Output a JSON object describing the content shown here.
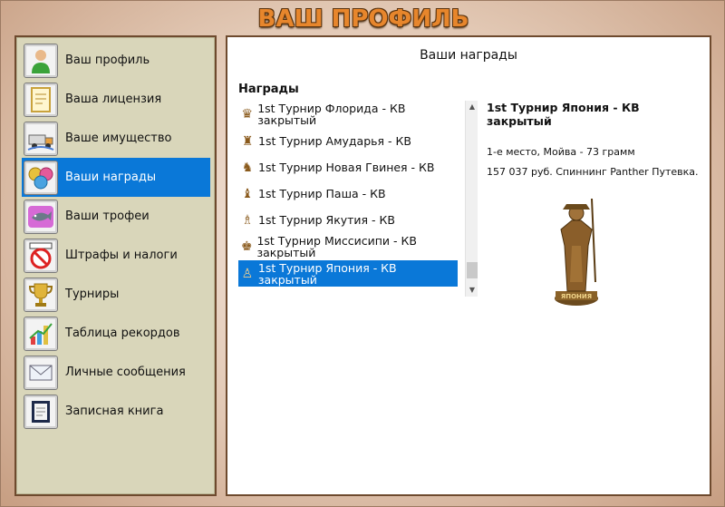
{
  "title": "ВАШ ПРОФИЛЬ",
  "sidebar": {
    "items": [
      {
        "label": "Ваш профиль",
        "icon": "user-icon",
        "active": false
      },
      {
        "label": "Ваша лицензия",
        "icon": "license-icon",
        "active": false
      },
      {
        "label": "Ваше имущество",
        "icon": "property-icon",
        "active": false
      },
      {
        "label": "Ваши награды",
        "icon": "awards-icon",
        "active": true
      },
      {
        "label": "Ваши трофеи",
        "icon": "fish-trophy-icon",
        "active": false
      },
      {
        "label": "Штрафы и налоги",
        "icon": "fine-icon",
        "active": false
      },
      {
        "label": "Турниры",
        "icon": "cup-icon",
        "active": false
      },
      {
        "label": "Таблица рекордов",
        "icon": "chart-icon",
        "active": false
      },
      {
        "label": "Личные сообщения",
        "icon": "mail-icon",
        "active": false
      },
      {
        "label": "Записная книга",
        "icon": "notebook-icon",
        "active": false
      }
    ]
  },
  "main": {
    "header": "Ваши награды",
    "list_title": "Награды",
    "rows": [
      {
        "label": "1st Турнир Флорида - КВ закрытый",
        "icon": "trophy-icon",
        "active": false
      },
      {
        "label": "1st Турнир Амударья - КВ",
        "icon": "trophy-icon",
        "active": false
      },
      {
        "label": "1st Турнир Новая Гвинея - КВ",
        "icon": "trophy-icon",
        "active": false
      },
      {
        "label": "1st Турнир Паша - КВ",
        "icon": "trophy-icon",
        "active": false
      },
      {
        "label": "1st Турнир Якутия - КВ",
        "icon": "trophy-icon",
        "active": false
      },
      {
        "label": "1st Турнир Миссисипи - КВ закрытый",
        "icon": "trophy-icon",
        "active": false
      },
      {
        "label": "1st Турнир Япония - КВ закрытый",
        "icon": "trophy-icon",
        "active": true
      }
    ],
    "detail": {
      "title": "1st Турнир Япония - КВ закрытый",
      "line1": "1-е место, Мойва - 73 грамм",
      "line2": "157 037 руб. Спиннинг Panther Путевка."
    },
    "trophy_label": "ЯПОНИЯ"
  },
  "colors": {
    "accent": "#0a78d8",
    "title": "#e7862c",
    "sidebar_bg": "#d9d6ba",
    "border": "#6e4a2e"
  }
}
